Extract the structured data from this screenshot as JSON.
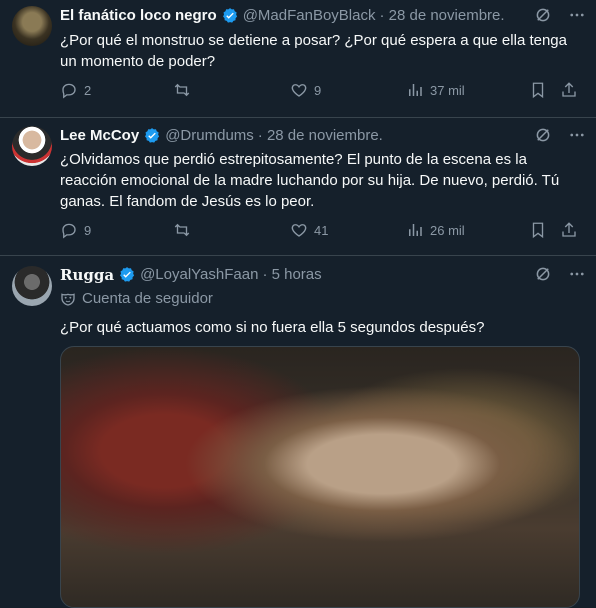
{
  "tweets": [
    {
      "name": "El fanático loco negro",
      "handle": "@MadFanBoyBlack",
      "date": "· 28 de noviembre.",
      "text": "¿Por qué el monstruo se detiene a posar? ¿Por qué espera a que ella tenga un momento de poder?",
      "replies": "2",
      "retweets": "",
      "likes": "9",
      "views": "37 mil"
    },
    {
      "name": "Lee McCoy",
      "handle": "@Drumdums",
      "date": "· 28 de noviembre.",
      "text": "¿Olvidamos que perdió estrepitosamente? El punto de la escena es la reacción emocional de la madre luchando por su hija. De nuevo, perdió. Tú ganas. El fandom de Jesús es lo peor.",
      "replies": "9",
      "retweets": "",
      "likes": "41",
      "views": "26 mil"
    },
    {
      "name": "Rugga",
      "handle": "@LoyalYashFaan",
      "date": "· 5 horas",
      "follower_tag": "Cuenta de seguidor",
      "text": "¿Por qué actuamos como si no fuera ella 5 segundos después?"
    }
  ],
  "colors": {
    "background": "#15202b",
    "verified": "#1d9bf0",
    "muted": "#8b98a5",
    "text": "#f7f9f9"
  }
}
